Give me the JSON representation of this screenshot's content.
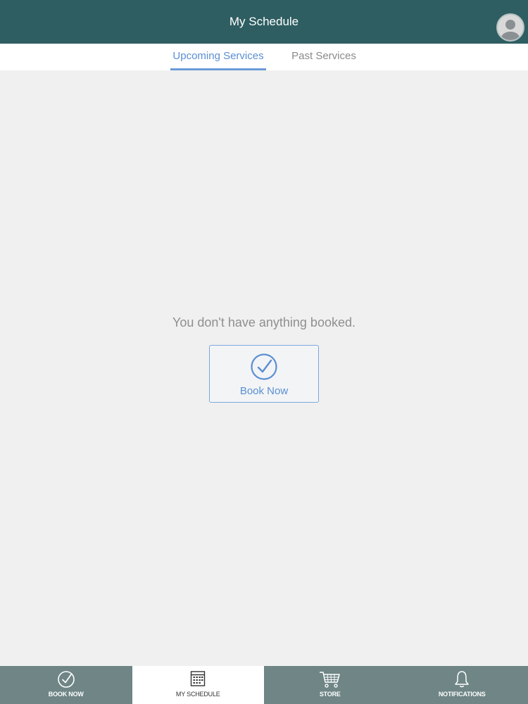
{
  "header": {
    "title": "My Schedule",
    "avatar_icon": "user-avatar-icon"
  },
  "tabs": [
    {
      "label": "Upcoming Services",
      "active": true
    },
    {
      "label": "Past Services",
      "active": false
    }
  ],
  "main": {
    "empty_message": "You don't have anything booked.",
    "book_button": {
      "label": "Book Now",
      "icon": "check-circle-icon"
    }
  },
  "bottom_nav": [
    {
      "label": "BOOK NOW",
      "icon": "check-circle-icon",
      "active": false
    },
    {
      "label": "MY SCHEDULE",
      "icon": "calendar-icon",
      "active": true
    },
    {
      "label": "STORE",
      "icon": "cart-icon",
      "active": false
    },
    {
      "label": "NOTIFICATIONS",
      "icon": "bell-icon",
      "active": false
    }
  ],
  "colors": {
    "header_bg": "#2e5e62",
    "accent": "#5b8fd1",
    "nav_bg": "#6f8586",
    "content_bg": "#f0f0f0"
  }
}
